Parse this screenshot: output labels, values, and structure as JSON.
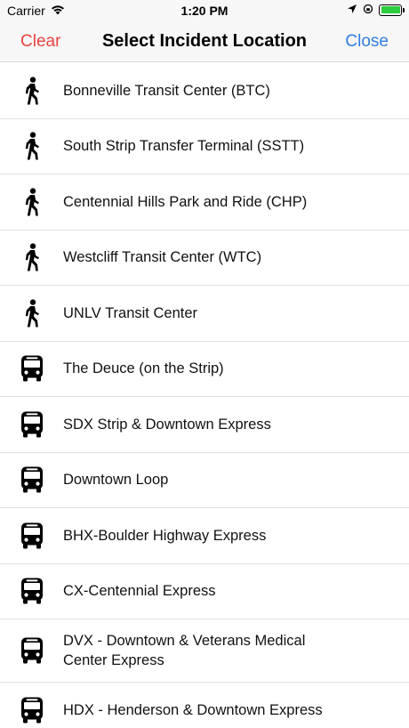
{
  "status_bar": {
    "carrier": "Carrier",
    "time": "1:20 PM",
    "battery_color": "#2ecc40"
  },
  "nav": {
    "clear_label": "Clear",
    "title": "Select Incident Location",
    "close_label": "Close",
    "clear_color": "#e8453c",
    "close_color": "#2f7de1"
  },
  "locations": [
    {
      "icon": "walking-person-icon",
      "label": "Bonneville Transit Center (BTC)"
    },
    {
      "icon": "walking-person-icon",
      "label": "South Strip Transfer Terminal (SSTT)"
    },
    {
      "icon": "walking-person-icon",
      "label": "Centennial Hills Park and Ride (CHP)"
    },
    {
      "icon": "walking-person-icon",
      "label": "Westcliff Transit Center (WTC)"
    },
    {
      "icon": "walking-person-icon",
      "label": "UNLV Transit Center"
    },
    {
      "icon": "bus-icon",
      "label": "The Deuce (on the Strip)"
    },
    {
      "icon": "bus-icon",
      "label": "SDX Strip & Downtown Express"
    },
    {
      "icon": "bus-icon",
      "label": "Downtown Loop"
    },
    {
      "icon": "bus-icon",
      "label": "BHX-Boulder Highway Express"
    },
    {
      "icon": "bus-icon",
      "label": "CX-Centennial Express"
    },
    {
      "icon": "bus-icon",
      "label": "DVX - Downtown & Veterans Medical Center Express"
    },
    {
      "icon": "bus-icon",
      "label": "HDX - Henderson & Downtown Express"
    }
  ]
}
